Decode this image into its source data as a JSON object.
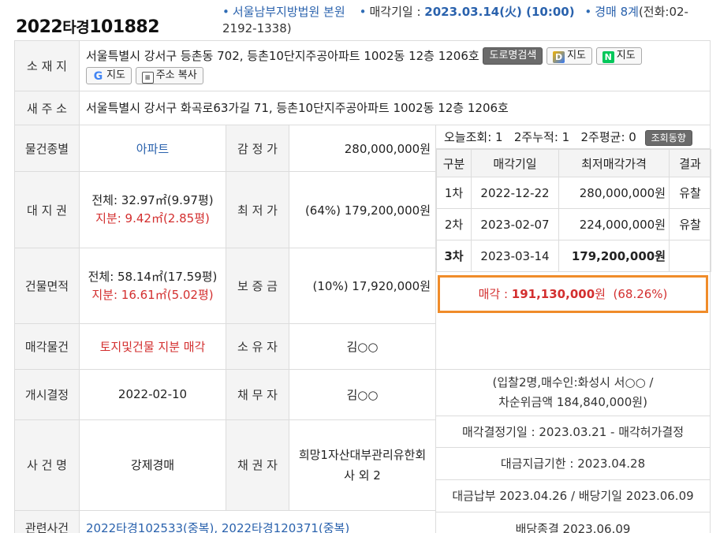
{
  "header": {
    "case_year": "2022",
    "case_type": "타경",
    "case_number": "101882",
    "court": "서울남부지방법원 본원",
    "sale_date_label": "매각기일 : ",
    "sale_date": "2023.03.14(火) (10:00)",
    "department": "경매 8계",
    "phone": "(전화:02-2192-1338)"
  },
  "location": {
    "label": "소 재 지",
    "address": "서울특별시 강서구 등촌동 702, 등촌10단지주공아파트 1002동 12층 1206호",
    "buttons": {
      "road_search": "도로명검색",
      "daum_map": "지도",
      "naver_map": "지도",
      "google_map": "지도",
      "copy_address": "주소 복사"
    }
  },
  "new_address": {
    "label": "새 주 소",
    "address": "서울특별시 강서구 화곡로63가길 71, 등촌10단지주공아파트 1002동 12층 1206호"
  },
  "details": {
    "property_type_label": "물건종별",
    "property_type": "아파트",
    "appraisal_label": "감 정 가",
    "appraisal": "280,000,000원",
    "land_label": "대 지 권",
    "land_total": "전체: 32.97㎡(9.97평)",
    "land_share": "지분: 9.42㎡(2.85평)",
    "min_price_label": "최 저 가",
    "min_price": "(64%) 179,200,000원",
    "building_label": "건물면적",
    "building_total": "전체: 58.14㎡(17.59평)",
    "building_share": "지분: 16.61㎡(5.02평)",
    "deposit_label": "보 증 금",
    "deposit": "(10%) 17,920,000원",
    "sale_item_label": "매각물건",
    "sale_item": "토지및건물 지분 매각",
    "owner_label": "소 유 자",
    "owner": "김○○",
    "start_label": "개시결정",
    "start_date": "2022-02-10",
    "debtor_label": "채 무 자",
    "debtor": "김○○",
    "case_name_label": "사 건 명",
    "case_name": "강제경매",
    "creditor_label": "채 권 자",
    "creditor": "희망1자산대부관리유한회사 외 2",
    "related_label": "관련사건",
    "related": "2022타경102533(중복), 2022타경120371(중복)"
  },
  "views": {
    "today_label": "오늘조회: ",
    "today": "1",
    "two_week_label": "2주누적: ",
    "two_week": "1",
    "avg_label": "2주평균: ",
    "avg": "0",
    "trend_button": "조회동향"
  },
  "history": {
    "headers": [
      "구분",
      "매각기일",
      "최저매각가격",
      "결과"
    ],
    "rows": [
      {
        "round": "1차",
        "date": "2022-12-22",
        "price": "280,000,000원",
        "result": "유찰"
      },
      {
        "round": "2차",
        "date": "2023-02-07",
        "price": "224,000,000원",
        "result": "유찰"
      },
      {
        "round": "3차",
        "date": "2023-03-14",
        "price": "179,200,000원",
        "result": ""
      }
    ]
  },
  "result": {
    "sale_label": "매각 : ",
    "sale_amount": "191,130,000",
    "sale_unit": "원",
    "sale_ratio": "(68.26%)",
    "bid_info_1": "(입찰2명,매수인:화성시 서○○ /",
    "bid_info_2": "차순위금액 184,840,000원)",
    "decision": "매각결정기일 : 2023.03.21 - 매각허가결정",
    "payment_deadline": "대금지급기한 : 2023.04.28",
    "payment": "대금납부 2023.04.26 / 배당기일 2023.06.09",
    "dividend": "배당종결 2023.06.09"
  },
  "colors": {
    "accent_blue": "#2a62ad",
    "share_red": "#d32f2f",
    "highlight_orange": "#f08c2a"
  }
}
